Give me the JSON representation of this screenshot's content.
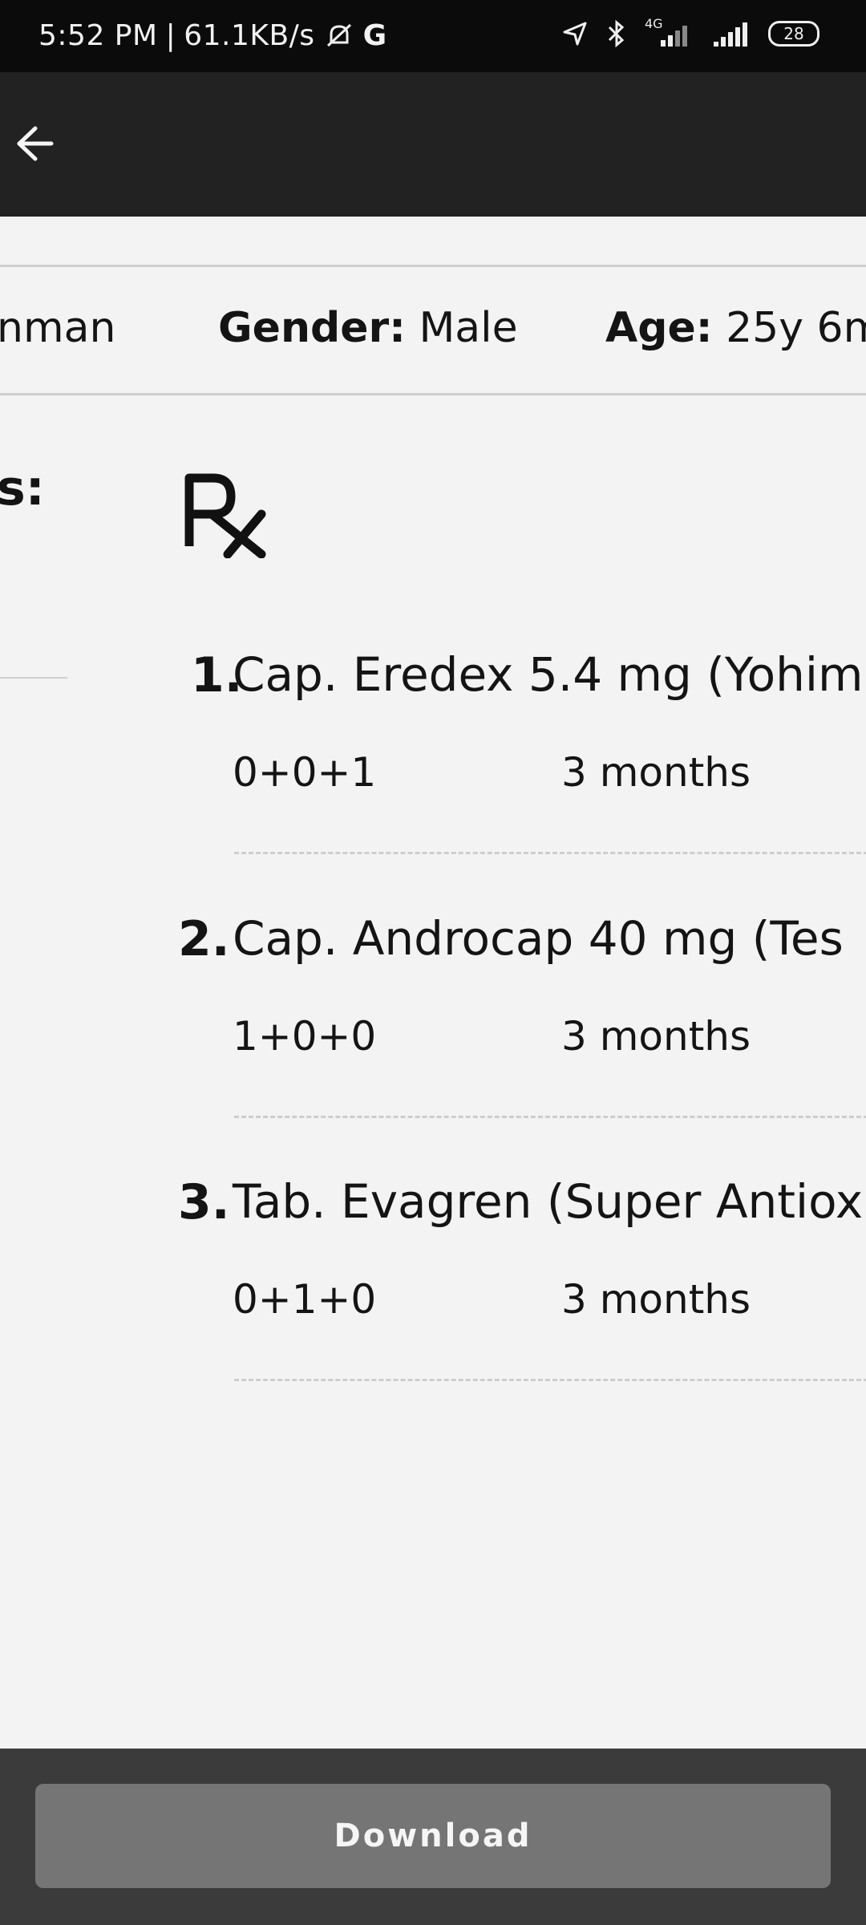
{
  "status_bar": {
    "time": "5:52 PM",
    "speed": "61.1KB/s",
    "network_label": "4G",
    "battery": "28"
  },
  "toolbar": {
    "back_icon": "arrow-left-icon"
  },
  "patient": {
    "name_fragment": "nman",
    "gender_label": "Gender:",
    "gender_value": "Male",
    "age_label": "Age:",
    "age_value": "25y 6m"
  },
  "left_heading_fragment": "s:",
  "rx_symbol": "rx-icon",
  "medications": [
    {
      "num": "1.",
      "name": "Cap. Eredex 5.4 mg (Yohim",
      "dosage": "0+0+1",
      "duration": "3 months"
    },
    {
      "num": "2.",
      "name": "Cap. Androcap 40 mg (Tes",
      "dosage": "1+0+0",
      "duration": "3 months"
    },
    {
      "num": "3.",
      "name": "Tab. Evagren (Super Antiox",
      "dosage": "0+1+0",
      "duration": "3 months"
    }
  ],
  "download_label": "Download",
  "colors": {
    "status_bar": "#0b0b0b",
    "toolbar": "#222222",
    "content_bg": "#f3f3f3",
    "bottom_bar": "#3b3b3b",
    "button": "#757575"
  }
}
